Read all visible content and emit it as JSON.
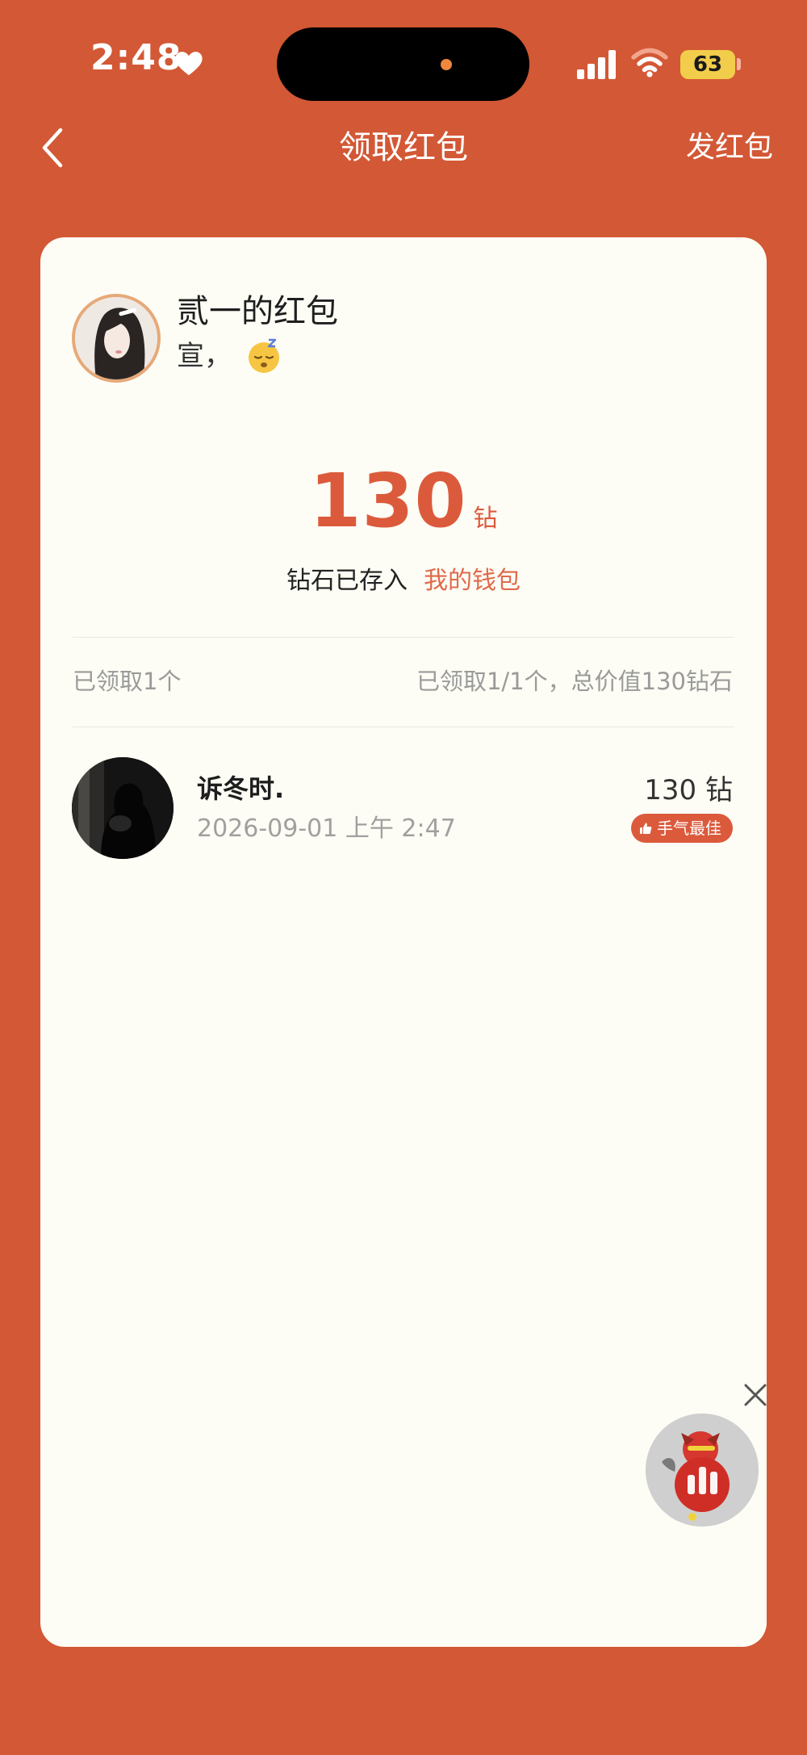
{
  "status_bar": {
    "time": "2:48",
    "battery": "63",
    "icons": [
      "heart-icon",
      "signal-icon",
      "wifi-icon",
      "battery-icon"
    ]
  },
  "nav": {
    "back_icon": "chevron-left-icon",
    "title": "领取红包",
    "send_label": "发红包"
  },
  "packet": {
    "title": "贰一的红包",
    "subtitle": "宣，",
    "emoji": "sleeping-face-emoji",
    "amount": "130",
    "unit": "钻",
    "deposit_text": "钻石已存入",
    "wallet_link": "我的钱包"
  },
  "summary": {
    "left": "已领取1个",
    "right": "已领取1/1个，总价值130钻石"
  },
  "claims": [
    {
      "name": "诉冬时.",
      "time": "2026-09-01 上午 2:47",
      "amount": "130 钻",
      "badge": "手气最佳"
    }
  ],
  "colors": {
    "background": "#d35835",
    "card": "#fdfdf5",
    "accent": "#dc5a3c",
    "link": "#e06a4c",
    "battery": "#f2cd4b",
    "muted_text": "#9a9a9a"
  }
}
